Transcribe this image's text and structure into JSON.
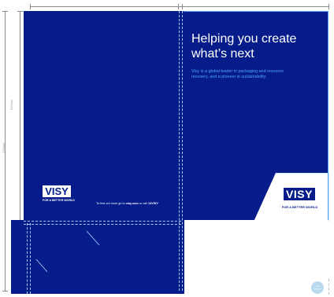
{
  "brand": {
    "navy": "#051c8a",
    "accent": "#4fa3ff",
    "logo_text": "VISY",
    "tagline": "FOR A BETTER WORLD"
  },
  "front": {
    "headline_line1": "Helping you create",
    "headline_line2": "what’s next",
    "body": "Visy is a global leader in packaging and resource recovery, and a pioneer in sustainability."
  },
  "back": {
    "footer_prefix": "To find out more go to ",
    "footer_site": "visy.com",
    "footer_mid": " or call ",
    "footer_phone": "13VISY",
    "footer_end": "."
  },
  "dimensions": {
    "height_top": "315mm",
    "height_total": "475mm"
  },
  "badge": {
    "line1": "FC",
    "line2": "PRINT"
  },
  "icons": [
    "logo-icon"
  ]
}
